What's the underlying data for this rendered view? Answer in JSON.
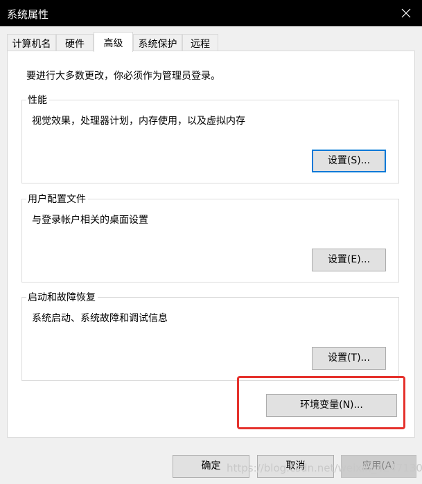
{
  "window": {
    "title": "系统属性",
    "close_icon": "close-icon"
  },
  "tabs": [
    {
      "label": "计算机名",
      "active": false
    },
    {
      "label": "硬件",
      "active": false
    },
    {
      "label": "高级",
      "active": true
    },
    {
      "label": "系统保护",
      "active": false
    },
    {
      "label": "远程",
      "active": false
    }
  ],
  "advanced": {
    "admin_note": "要进行大多数更改，你必须作为管理员登录。",
    "performance": {
      "title": "性能",
      "description": "视觉效果，处理器计划，内存使用，以及虚拟内存",
      "button": "设置(S)..."
    },
    "user_profiles": {
      "title": "用户配置文件",
      "description": "与登录帐户相关的桌面设置",
      "button": "设置(E)..."
    },
    "startup_recovery": {
      "title": "启动和故障恢复",
      "description": "系统启动、系统故障和调试信息",
      "button": "设置(T)..."
    },
    "env_button": "环境变量(N)..."
  },
  "footer": {
    "ok": "确定",
    "cancel": "取消",
    "apply": "应用(A)"
  },
  "watermark": "https://blog.csdn.net/weixin_42471304",
  "colors": {
    "focus_border": "#0078d7",
    "highlight": "#e5322d"
  }
}
